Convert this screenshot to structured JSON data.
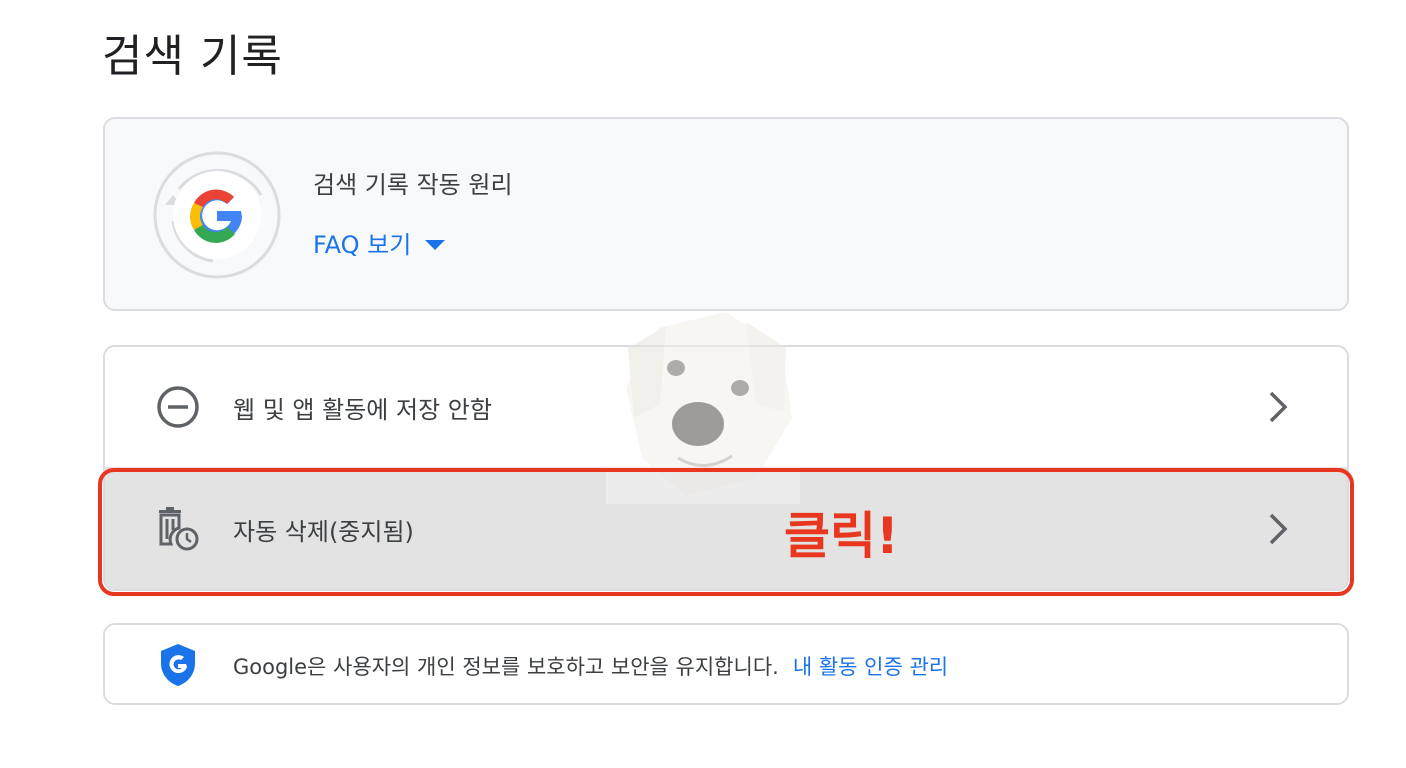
{
  "page": {
    "title": "검색 기록"
  },
  "info_card": {
    "title": "검색 기록 작동 원리",
    "faq_link": "FAQ 보기"
  },
  "settings": {
    "web_app_activity": "웹 및 앱 활동에 저장 안함",
    "auto_delete": "자동 삭제(중지됨)"
  },
  "annotation": {
    "click_label": "클릭!"
  },
  "security": {
    "text": "Google은 사용자의 개인 정보를 보호하고 보안을 유지합니다.",
    "link": "내 활동 인증 관리"
  },
  "colors": {
    "link_blue": "#1a73e8",
    "highlight_red": "#e8361f",
    "selected_row_bg": "#e3e3e3"
  },
  "icons": {
    "history_google": "google-history-icon",
    "web_app": "minus-circle-icon",
    "auto_delete": "trash-clock-icon",
    "chevron": "chevron-right-icon",
    "shield": "shield-g-icon"
  }
}
